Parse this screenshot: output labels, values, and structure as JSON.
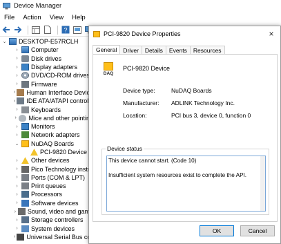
{
  "device_manager": {
    "title": "Device Manager",
    "menu": [
      "File",
      "Action",
      "View",
      "Help"
    ],
    "tree": [
      {
        "label": "DESKTOP-E57RCLH",
        "level": 0,
        "expander": "v",
        "icon": "computer-icon",
        "cls": "ic-pc"
      },
      {
        "label": "Computer",
        "level": 1,
        "expander": ">",
        "icon": "computer-icon",
        "cls": "ic-pc"
      },
      {
        "label": "Disk drives",
        "level": 1,
        "expander": ">",
        "icon": "disk-drive-icon",
        "cls": "ic-disk"
      },
      {
        "label": "Display adapters",
        "level": 1,
        "expander": ">",
        "icon": "display-adapter-icon",
        "cls": "ic-mon"
      },
      {
        "label": "DVD/CD-ROM drives",
        "level": 1,
        "expander": ">",
        "icon": "dvd-icon",
        "cls": "ic-dvd"
      },
      {
        "label": "Firmware",
        "level": 1,
        "expander": ">",
        "icon": "firmware-icon",
        "cls": "ic-fw"
      },
      {
        "label": "Human Interface Device",
        "level": 1,
        "expander": ">",
        "icon": "hid-icon",
        "cls": "ic-hid"
      },
      {
        "label": "IDE ATA/ATAPI controlle",
        "level": 1,
        "expander": ">",
        "icon": "ide-controller-icon",
        "cls": "ic-ide"
      },
      {
        "label": "Keyboards",
        "level": 1,
        "expander": ">",
        "icon": "keyboard-icon",
        "cls": "ic-kbd"
      },
      {
        "label": "Mice and other pointing",
        "level": 1,
        "expander": ">",
        "icon": "mouse-icon",
        "cls": "ic-mouse"
      },
      {
        "label": "Monitors",
        "level": 1,
        "expander": ">",
        "icon": "monitor-icon",
        "cls": "ic-mon"
      },
      {
        "label": "Network adapters",
        "level": 1,
        "expander": ">",
        "icon": "network-adapter-icon",
        "cls": "ic-net"
      },
      {
        "label": "NuDAQ Boards",
        "level": 1,
        "expander": "v",
        "icon": "daq-board-icon",
        "cls": "ic-daq"
      },
      {
        "label": "PCI-9820 Device",
        "level": 2,
        "expander": "",
        "icon": "warning-icon",
        "cls": "ic-warn"
      },
      {
        "label": "Other devices",
        "level": 1,
        "expander": ">",
        "icon": "other-devices-icon",
        "cls": "ic-warn"
      },
      {
        "label": "Pico Technology instru",
        "level": 1,
        "expander": ">",
        "icon": "pico-instrument-icon",
        "cls": "ic-plug"
      },
      {
        "label": "Ports (COM & LPT)",
        "level": 1,
        "expander": ">",
        "icon": "port-icon",
        "cls": "ic-print"
      },
      {
        "label": "Print queues",
        "level": 1,
        "expander": ">",
        "icon": "printer-icon",
        "cls": "ic-print"
      },
      {
        "label": "Processors",
        "level": 1,
        "expander": ">",
        "icon": "processor-icon",
        "cls": "ic-cpu"
      },
      {
        "label": "Software devices",
        "level": 1,
        "expander": ">",
        "icon": "software-device-icon",
        "cls": "ic-sw"
      },
      {
        "label": "Sound, video and game",
        "level": 1,
        "expander": ">",
        "icon": "sound-icon",
        "cls": "ic-snd"
      },
      {
        "label": "Storage controllers",
        "level": 1,
        "expander": ">",
        "icon": "storage-controller-icon",
        "cls": "ic-stor"
      },
      {
        "label": "System devices",
        "level": 1,
        "expander": ">",
        "icon": "system-device-icon",
        "cls": "ic-sys"
      },
      {
        "label": "Universal Serial Bus con",
        "level": 1,
        "expander": ">",
        "icon": "usb-icon",
        "cls": "ic-usb"
      }
    ]
  },
  "dialog": {
    "title": "PCI-9820 Device Properties",
    "close_label": "×",
    "tabs": [
      {
        "label": "General",
        "active": true
      },
      {
        "label": "Driver",
        "active": false
      },
      {
        "label": "Details",
        "active": false
      },
      {
        "label": "Events",
        "active": false
      },
      {
        "label": "Resources",
        "active": false
      }
    ],
    "device_icon_label": "DAQ",
    "device_name": "PCI-9820 Device",
    "properties": {
      "type_label": "Device type:",
      "type_value": "NuDAQ Boards",
      "manufacturer_label": "Manufacturer:",
      "manufacturer_value": "ADLINK Technology Inc.",
      "location_label": "Location:",
      "location_value": "PCI bus 3, device 0, function 0"
    },
    "status": {
      "legend": "Device status",
      "line1": "This device cannot start. (Code 10)",
      "line2": "Insufficient system resources exist to complete the API."
    },
    "ok_label": "OK",
    "cancel_label": "Cancel"
  }
}
